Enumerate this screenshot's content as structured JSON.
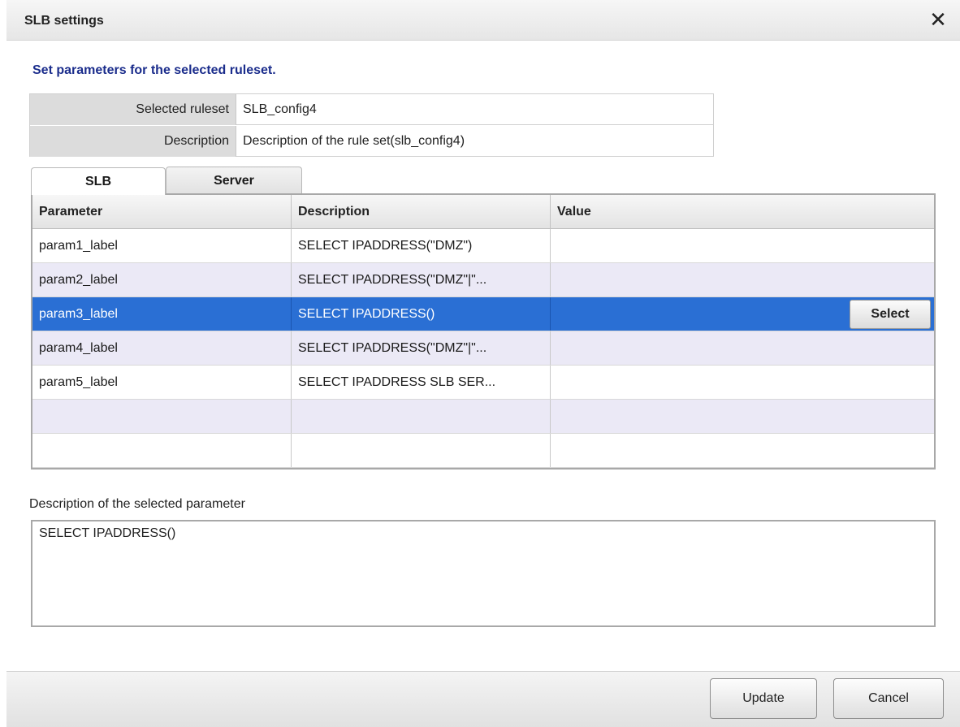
{
  "window": {
    "title": "SLB settings",
    "close_glyph": "✕"
  },
  "heading": "Set parameters for the selected ruleset.",
  "ruleset": {
    "selected_label": "Selected ruleset",
    "selected_value": "SLB_config4",
    "description_label": "Description",
    "description_value": "Description of the rule set(slb_config4)"
  },
  "tabs": [
    {
      "label": "SLB",
      "active": true
    },
    {
      "label": "Server",
      "active": false
    }
  ],
  "grid": {
    "columns": [
      "Parameter",
      "Description",
      "Value"
    ],
    "rows": [
      {
        "parameter": "param1_label",
        "description": "SELECT IPADDRESS(\"DMZ\")",
        "value": ""
      },
      {
        "parameter": "param2_label",
        "description": "SELECT IPADDRESS(\"DMZ\"|\"...",
        "value": ""
      },
      {
        "parameter": "param3_label",
        "description": "SELECT IPADDRESS()",
        "value": ""
      },
      {
        "parameter": "param4_label",
        "description": "SELECT IPADDRESS(\"DMZ\"|\"...",
        "value": ""
      },
      {
        "parameter": "param5_label",
        "description": "SELECT IPADDRESS SLB SER...",
        "value": ""
      },
      {
        "parameter": "",
        "description": "",
        "value": ""
      },
      {
        "parameter": "",
        "description": "",
        "value": ""
      }
    ],
    "selected_row": 3,
    "select_button_label": "Select"
  },
  "selected_param": {
    "label": "Description of the selected parameter",
    "text": "SELECT IPADDRESS()"
  },
  "buttons": {
    "update": "Update",
    "cancel": "Cancel"
  },
  "colors": {
    "selection": "#2a6fd4",
    "heading": "#1b2d8c",
    "alt_row": "#ebe9f6"
  },
  "icons": {
    "close": "close-icon"
  }
}
